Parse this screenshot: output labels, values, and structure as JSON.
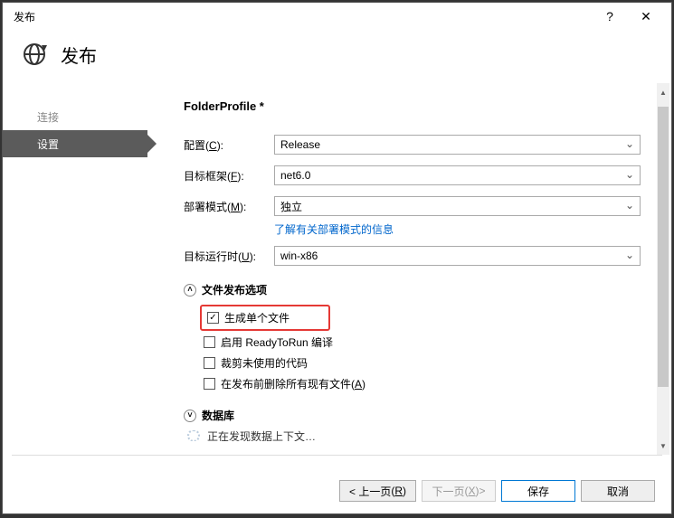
{
  "titlebar": {
    "title": "发布"
  },
  "header": {
    "title": "发布"
  },
  "sidebar": {
    "items": [
      {
        "label": "连接",
        "active": false
      },
      {
        "label": "设置",
        "active": true
      }
    ]
  },
  "main": {
    "profile_title": "FolderProfile *",
    "fields": {
      "config": {
        "label_text": "配置",
        "label_key": "C",
        "value": "Release"
      },
      "framework": {
        "label_text": "目标框架",
        "label_key": "F",
        "value": "net6.0"
      },
      "deploy_mode": {
        "label_text": "部署模式",
        "label_key": "M",
        "value": "独立",
        "link": "了解有关部署模式的信息"
      },
      "runtime": {
        "label_text": "目标运行时",
        "label_key": "U",
        "value": "win-x86"
      }
    },
    "sections": {
      "file_publish": {
        "title": "文件发布选项",
        "options": {
          "single_file": {
            "label": "生成单个文件",
            "checked": true,
            "highlight": true
          },
          "ready_to_run": {
            "label": "启用 ReadyToRun 编译",
            "checked": false
          },
          "trim": {
            "label": "裁剪未使用的代码",
            "checked": false
          },
          "delete_existing": {
            "label_text": "在发布前删除所有现有文件",
            "label_key": "A",
            "checked": false
          }
        }
      },
      "database": {
        "title": "数据库",
        "loading_text": "正在发现数据上下文…"
      }
    }
  },
  "footer": {
    "prev": {
      "text": "< 上一页",
      "key": "R"
    },
    "next": {
      "text": "下一页",
      "key": "X",
      "suffix": " >"
    },
    "save": "保存",
    "cancel": "取消"
  }
}
